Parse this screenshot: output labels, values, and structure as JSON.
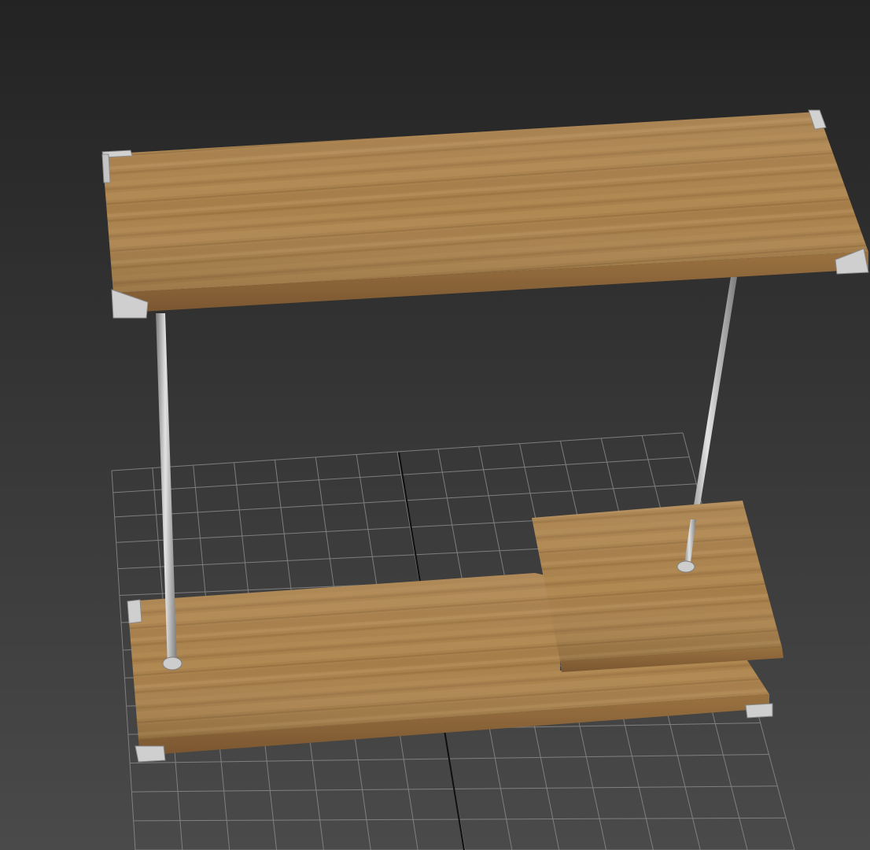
{
  "viewport": {
    "background_top": "#232323",
    "background_bottom": "#4a4a4a",
    "grid_color": "#8a8a8a",
    "grid_axis_color": "#0e0e0e"
  },
  "scene": {
    "wood_base": "#a07a47",
    "wood_light": "#c09a62",
    "wood_dark": "#7e5a31",
    "metal_color": "#c6c6c6",
    "metal_dark": "#7f7f7f",
    "objects": [
      "top-shelf",
      "bottom-shelf",
      "raised-step-shelf",
      "left-rod",
      "right-rod",
      "corner-brackets"
    ]
  }
}
